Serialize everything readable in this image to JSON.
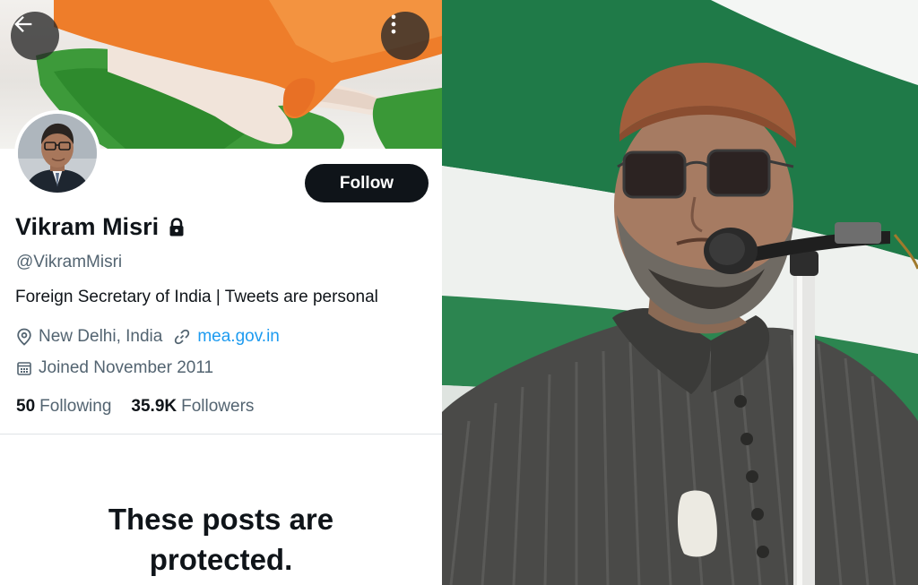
{
  "profile": {
    "follow_label": "Follow",
    "display_name": "Vikram Misri",
    "handle": "@VikramMisri",
    "bio": "Foreign Secretary of India | Tweets are personal",
    "location": "New Delhi, India",
    "website": "mea.gov.in",
    "joined": "Joined November 2011",
    "following_count": "50",
    "following_label": "Following",
    "followers_count": "35.9K",
    "followers_label": "Followers",
    "protected_line1": "These posts are",
    "protected_line2": "protected."
  },
  "icons": {
    "back": "arrow-left-icon",
    "more": "more-vertical-icon",
    "lock": "lock-icon",
    "location": "location-pin-icon",
    "link": "link-icon",
    "calendar": "calendar-icon"
  },
  "colors": {
    "text_primary": "#0f1419",
    "text_secondary": "#536471",
    "link": "#1d9bf0",
    "follow_button": "#0f1419"
  }
}
